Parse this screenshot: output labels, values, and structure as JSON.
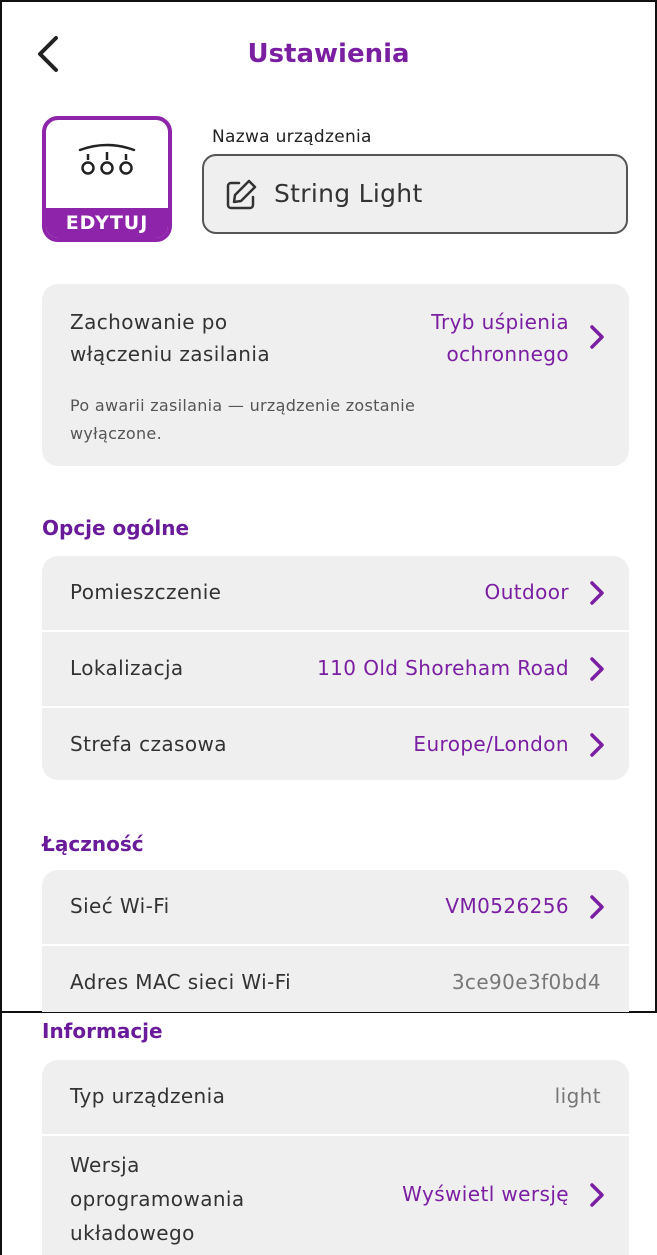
{
  "header": {
    "title": "Ustawienia"
  },
  "device": {
    "edit_label": "EDYTUJ",
    "name_label": "Nazwa urządzenia",
    "name_value": "String Light"
  },
  "power": {
    "label_line1": "Zachowanie po",
    "label_line2": "włączeniu zasilania",
    "value_line1": "Tryb uśpienia",
    "value_line2": "ochronnego",
    "note_line1": "Po awarii zasilania — urządzenie zostanie",
    "note_line2": "wyłączone."
  },
  "general": {
    "title": "Opcje ogólne",
    "rows": [
      {
        "label": "Pomieszczenie",
        "value": "Outdoor"
      },
      {
        "label": "Lokalizacja",
        "value": "110 Old Shoreham Road"
      },
      {
        "label": "Strefa czasowa",
        "value": "Europe/London"
      }
    ]
  },
  "connectivity": {
    "title": "Łączność",
    "rows": [
      {
        "label": "Sieć Wi-Fi",
        "value": "VM0526256"
      },
      {
        "label": "Adres MAC sieci Wi-Fi",
        "value": "3ce90e3f0bd4"
      }
    ]
  },
  "info": {
    "title": "Informacje",
    "device_type_label": "Typ urządzenia",
    "device_type_value": "light",
    "firmware_label_line1": "Wersja",
    "firmware_label_line2": "oprogramowania",
    "firmware_label_line3": "układowego",
    "firmware_value": "Wyświetl wersję"
  },
  "colors": {
    "accent": "#7b1fa2",
    "card_bg": "#efefef"
  }
}
